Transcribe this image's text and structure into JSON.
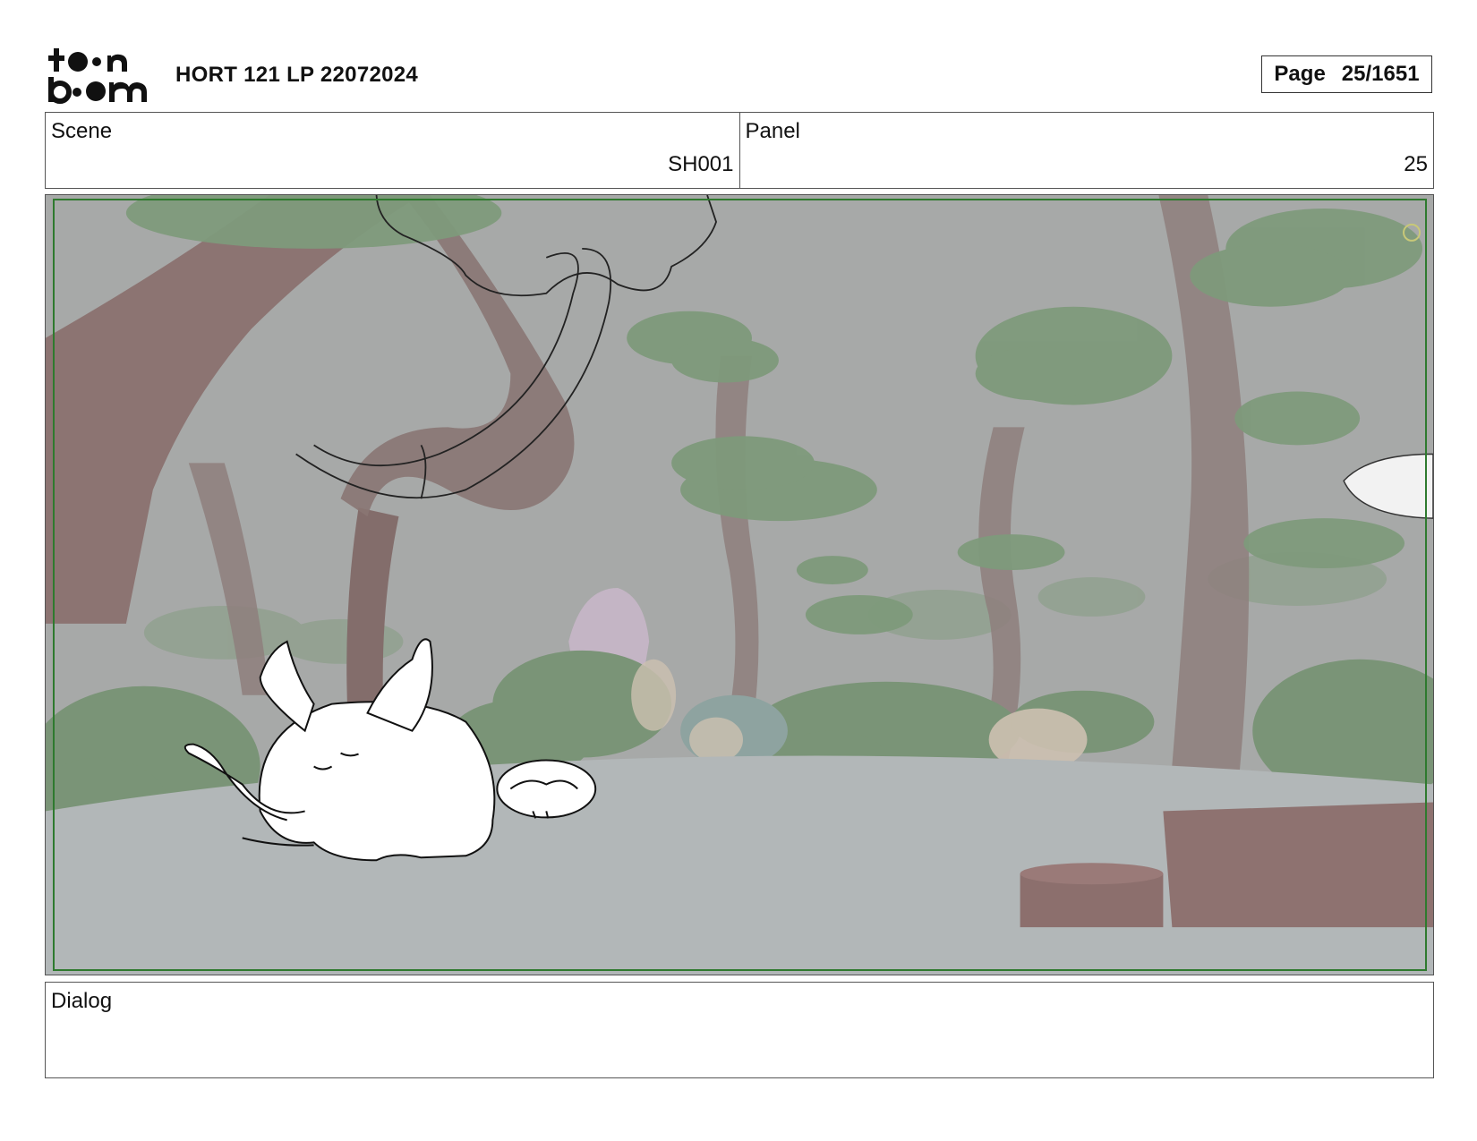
{
  "header": {
    "logo": "toon boom",
    "title": "HORT 121 LP 22072024",
    "page_label": "Page",
    "page_value": "25/1651"
  },
  "info": {
    "scene_label": "Scene",
    "scene_value": "SH001",
    "panel_label": "Panel",
    "panel_value": "25"
  },
  "dialog": {
    "label": "Dialog"
  },
  "colors": {
    "safe_frame": "#2e7a2e",
    "background_fog": "#a8aaa9",
    "ground": "#b3b8b9"
  }
}
